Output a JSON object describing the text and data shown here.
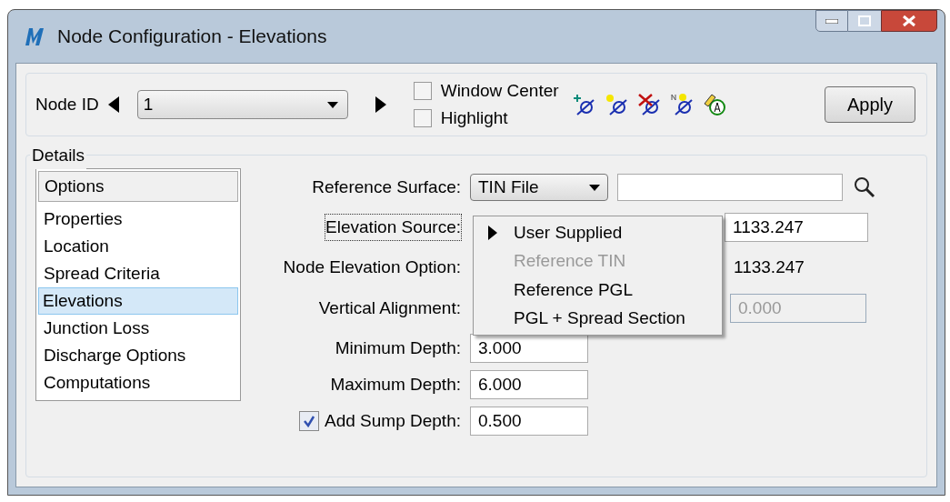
{
  "window": {
    "title": "Node Configuration - Elevations"
  },
  "toolbar": {
    "node_id_label": "Node ID",
    "node_id_value": "1",
    "window_center": {
      "label": "Window Center",
      "checked": false
    },
    "highlight": {
      "label": "Highlight",
      "checked": false
    },
    "apply_button": "Apply"
  },
  "details": {
    "title": "Details",
    "options_list": {
      "header": "Options",
      "items": [
        {
          "label": "Properties",
          "selected": false
        },
        {
          "label": "Location",
          "selected": false
        },
        {
          "label": "Spread Criteria",
          "selected": false
        },
        {
          "label": "Elevations",
          "selected": true
        },
        {
          "label": "Junction Loss",
          "selected": false
        },
        {
          "label": "Discharge Options",
          "selected": false
        },
        {
          "label": "Computations",
          "selected": false
        }
      ]
    },
    "reference_surface": {
      "label": "Reference Surface:",
      "value": "TIN File"
    },
    "elevation_source": {
      "label": "Elevation Source:",
      "value": "1133.247"
    },
    "node_elevation_option": {
      "label": "Node Elevation Option:",
      "value": "1133.247"
    },
    "vertical_alignment": {
      "label": "Vertical Alignment:",
      "value": "0.000",
      "disabled": true
    },
    "minimum_depth": {
      "label": "Minimum Depth:",
      "value": "3.000"
    },
    "maximum_depth": {
      "label": "Maximum Depth:",
      "value": "6.000"
    },
    "add_sump_depth": {
      "label": "Add Sump Depth:",
      "checked": true,
      "value": "0.500"
    }
  },
  "dropdown_menu": {
    "items": [
      {
        "label": "User Supplied",
        "selected": true,
        "disabled": false
      },
      {
        "label": "Reference TIN",
        "selected": false,
        "disabled": true
      },
      {
        "label": "Reference PGL",
        "selected": false,
        "disabled": false
      },
      {
        "label": "PGL + Spread Section",
        "selected": false,
        "disabled": false
      }
    ]
  }
}
